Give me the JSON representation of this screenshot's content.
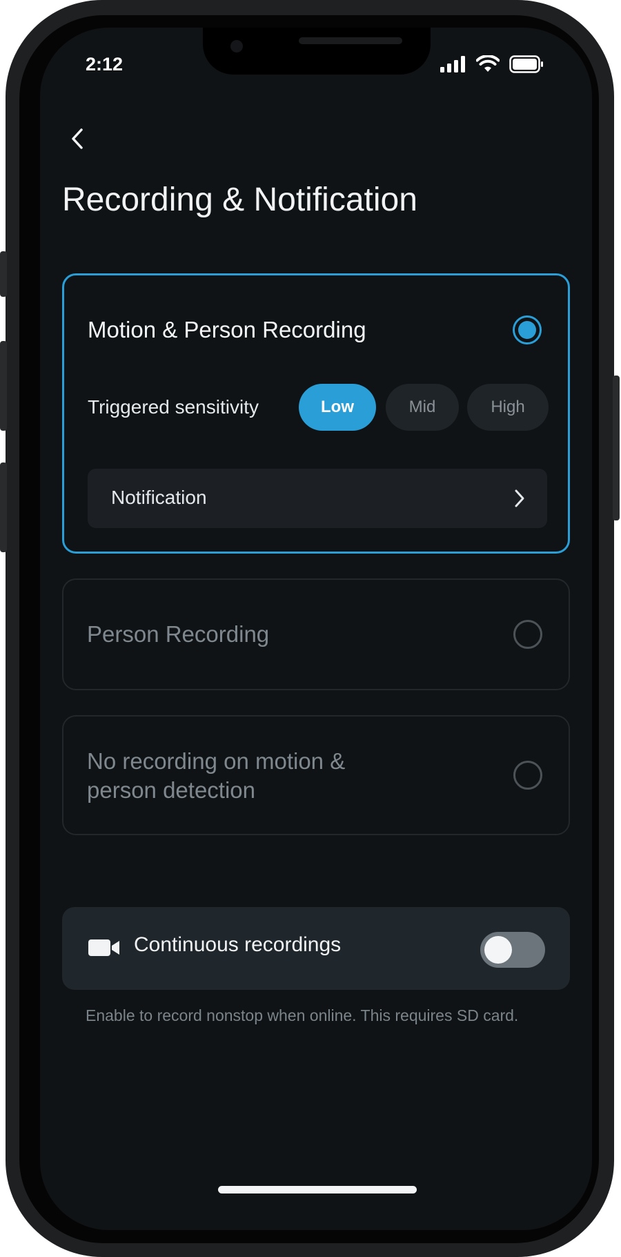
{
  "status_bar": {
    "time": "2:12"
  },
  "header": {
    "title": "Recording & Notification"
  },
  "options": [
    {
      "title": "Motion & Person Recording",
      "selected": true,
      "sensitivity": {
        "label": "Triggered sensitivity",
        "levels": [
          "Low",
          "Mid",
          "High"
        ],
        "current": "Low"
      },
      "notification_label": "Notification"
    },
    {
      "title": "Person Recording",
      "selected": false
    },
    {
      "title_line1": "No recording on motion &",
      "title_line2": "person detection",
      "selected": false
    }
  ],
  "continuous": {
    "label": "Continuous recordings",
    "enabled": false,
    "helper_text": "Enable to record nonstop when online. This requires SD card."
  },
  "colors": {
    "accent": "#2a9ed6",
    "background": "#101315"
  }
}
